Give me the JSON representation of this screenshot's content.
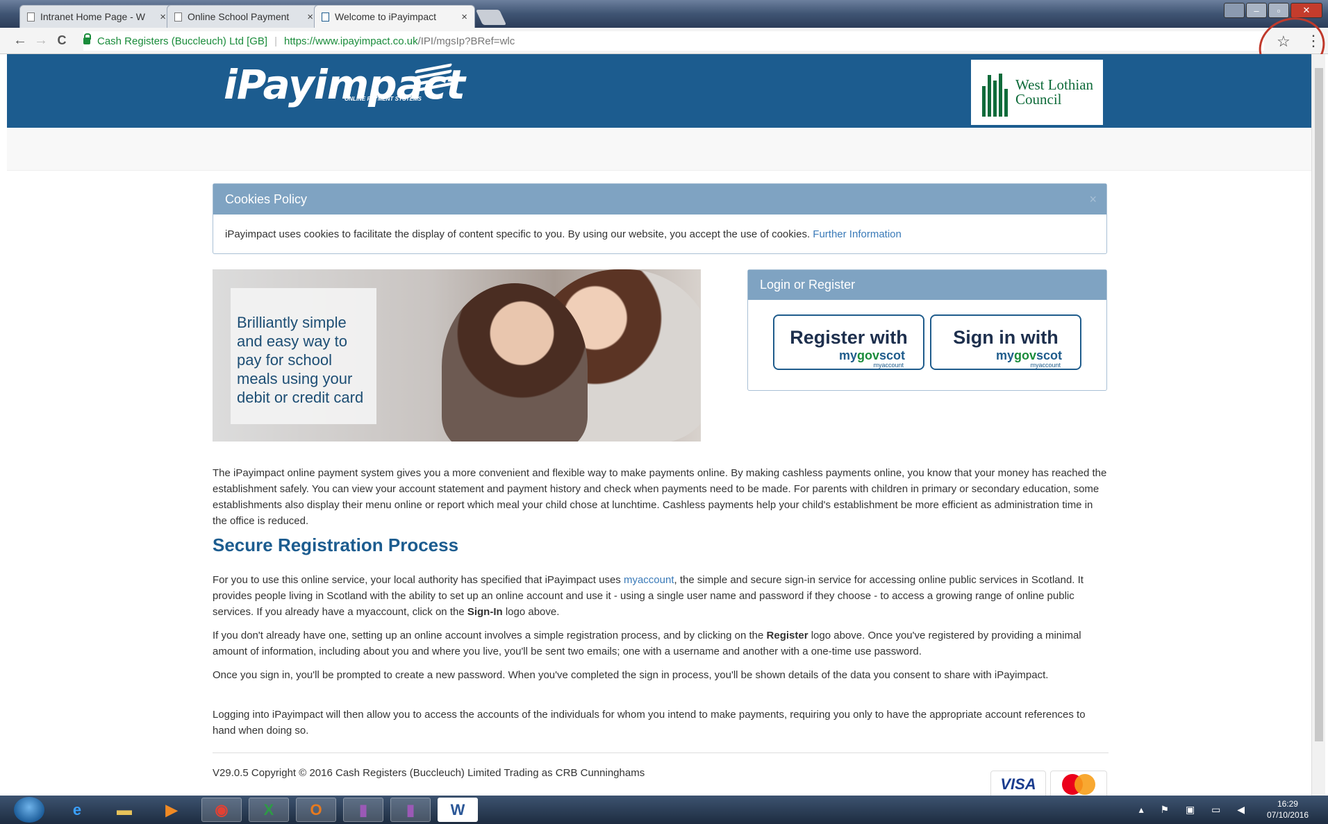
{
  "browser": {
    "tabs": [
      {
        "label": "Intranet Home Page - W"
      },
      {
        "label": "Online School Payment"
      },
      {
        "label": "Welcome to iPayimpact"
      }
    ],
    "close_glyph": "×",
    "star_glyph": "☆",
    "menu_glyph": "⋮",
    "back_glyph": "←",
    "forward_glyph": "→",
    "reload_glyph": "C",
    "security_label": "Cash Registers (Buccleuch) Ltd [GB]",
    "url_host": "https://www.ipayimpact.co.uk",
    "url_path": "/IPI/mgsIp?BRef=wlc"
  },
  "header": {
    "logo_text": "iPayimpact",
    "logo_sub": "ONLINE PAYMENT SYSTEMS",
    "council_line1": "West Lothian",
    "council_line2": "Council"
  },
  "cookies": {
    "title": "Cookies Policy",
    "close_glyph": "×",
    "body": "iPayimpact uses cookies to facilitate the display of content specific to you. By using our website, you accept the use of cookies.",
    "link": "Further Information"
  },
  "hero": {
    "lines": [
      "Brilliantly simple",
      "and easy way to",
      "pay for school",
      "meals using your",
      "debit or credit card"
    ]
  },
  "login": {
    "title": "Login or Register",
    "register_label": "Register with",
    "signin_label": "Sign in with",
    "brand_my": "my",
    "brand_gov": "gov",
    "brand_scot": "scot",
    "brand_sub": "myaccount"
  },
  "content": {
    "intro": "The iPayimpact online payment system gives you a more convenient and flexible way to make payments online. By making cashless payments online, you know that your money has reached the establishment safely. You can view your account statement and payment history and check when payments need to be made. For parents with children in primary or secondary education, some establishments also display their menu online or report which meal your child chose at lunchtime. Cashless payments help your child's establishment be more efficient as administration time in the office is reduced.",
    "section_title": "Secure Registration Process",
    "p1_a": "For you to use this online service, your local authority has specified that iPayimpact uses ",
    "p1_link": "myaccount",
    "p1_b": ", the simple and secure sign-in service for accessing online public services in Scotland. It provides people living in Scotland with the ability to set up an online account and use it - using a single user name and password if they choose - to access a growing range of online public services. If you already have a myaccount, click on the ",
    "p1_bold": "Sign-In",
    "p1_c": " logo above.",
    "p2_a": "If you don't already have one, setting up an online account involves a simple registration process, and by clicking on the ",
    "p2_bold": "Register",
    "p2_b": " logo above. Once you've registered by providing a minimal amount of information, including about you and where you live, you'll be sent two emails; one with a username and another with a one-time use password.",
    "p3": "Once you sign in, you'll be prompted to create a new password. When you've completed the sign in process, you'll be shown details of the data you consent to share with iPayimpact.",
    "p4": "Logging into iPayimpact will then allow you to access the accounts of the individuals for whom you intend to make payments, requiring you only to have the appropriate account references to hand when doing so."
  },
  "footer": {
    "copyright": "V29.0.5 Copyright © 2016 Cash Registers (Buccleuch) Limited Trading as CRB Cunninghams",
    "visa": "VISA",
    "mastercard": "MasterCard"
  },
  "taskbar": {
    "time": "16:29",
    "date": "07/10/2016"
  },
  "colors": {
    "header_blue": "#1c5c8f",
    "panel_head": "#7fa3c2",
    "link": "#3a7ab8",
    "secure_green": "#1a8c3b"
  }
}
